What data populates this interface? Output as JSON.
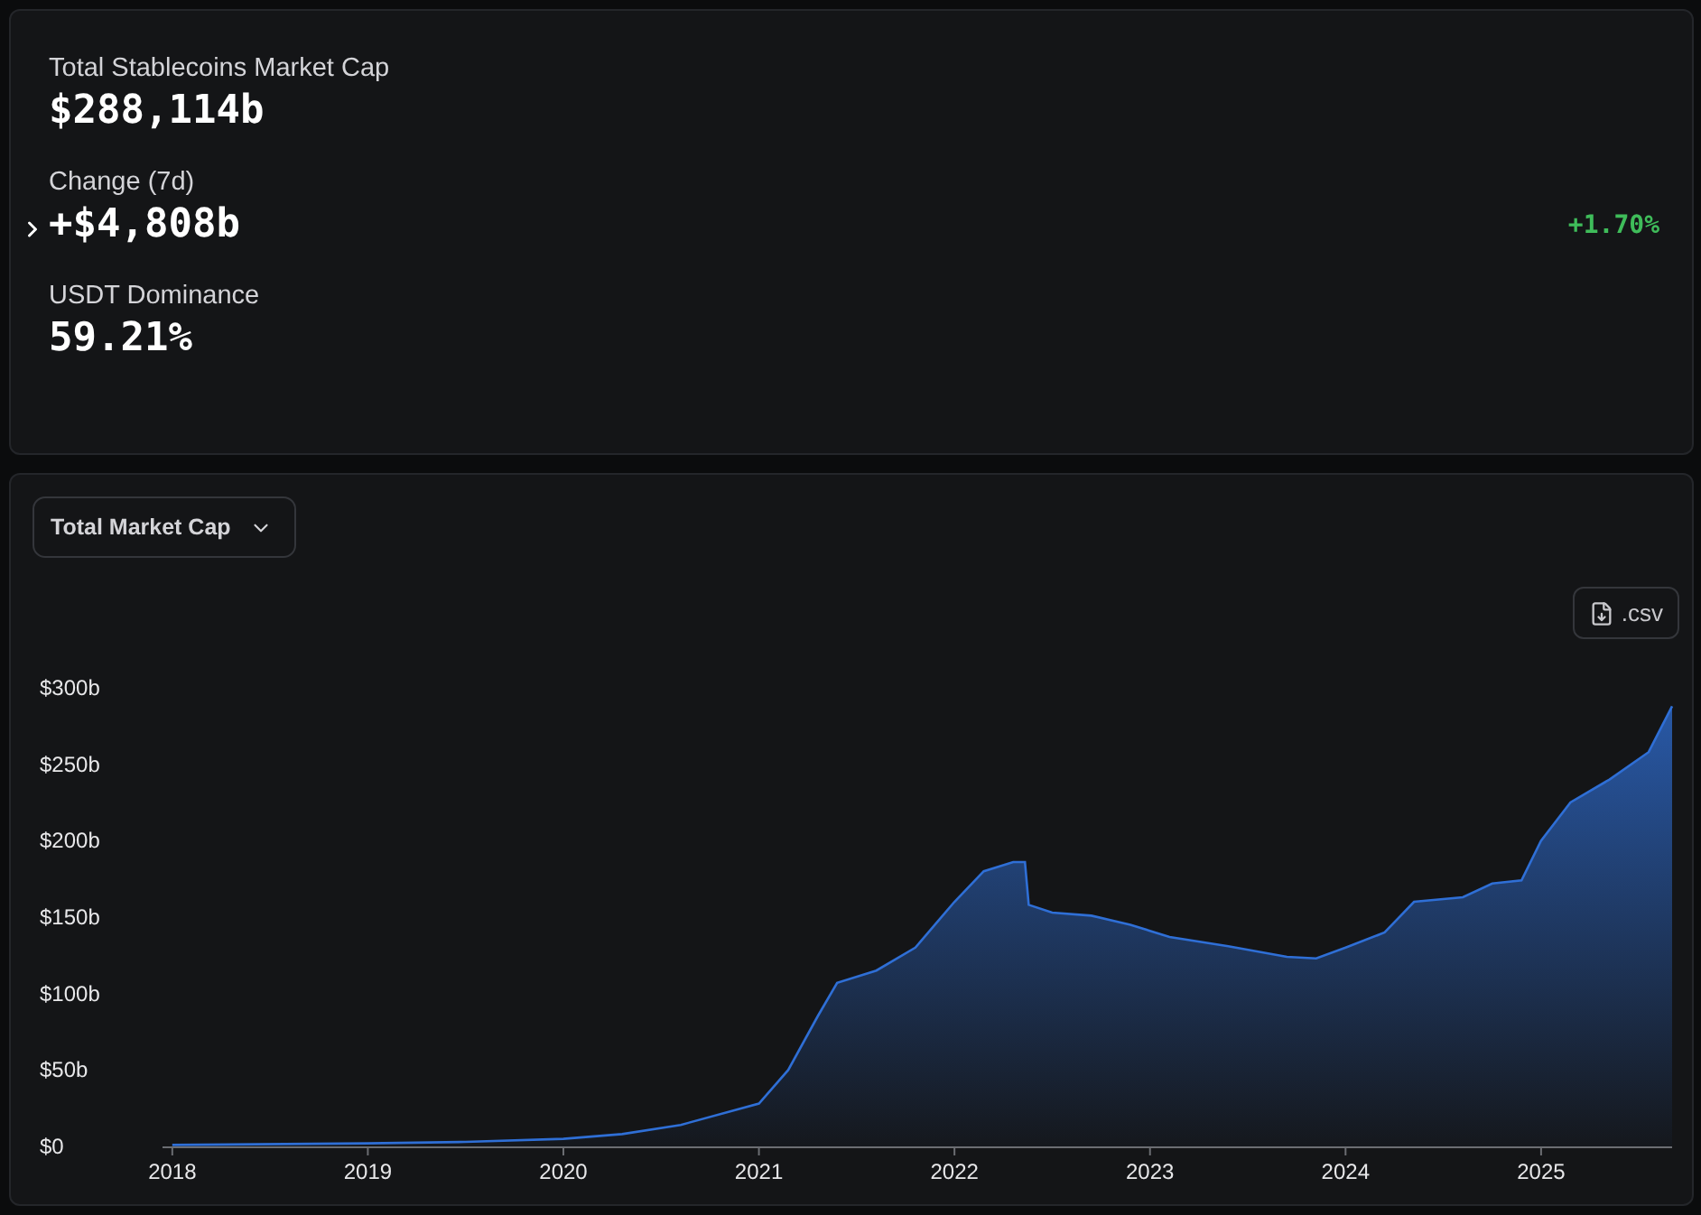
{
  "summary": {
    "stats": [
      {
        "label": "Total Stablecoins Market Cap",
        "value": "$288,114b"
      },
      {
        "label": "Change (7d)",
        "value": "+$4,808b",
        "change": "+1.70%",
        "expanded": false
      },
      {
        "label": "USDT Dominance",
        "value": "59.21%"
      }
    ]
  },
  "chart_panel": {
    "metric_select": {
      "value": "Total Market Cap"
    },
    "export_button": {
      "label": ".csv"
    },
    "chart_data": {
      "type": "area",
      "x": [
        2018.0,
        2019.0,
        2019.5,
        2020.0,
        2020.3,
        2020.6,
        2021.0,
        2021.15,
        2021.3,
        2021.4,
        2021.6,
        2021.8,
        2022.0,
        2022.15,
        2022.3,
        2022.36,
        2022.38,
        2022.5,
        2022.7,
        2022.9,
        2023.1,
        2023.4,
        2023.7,
        2023.85,
        2024.0,
        2024.2,
        2024.35,
        2024.6,
        2024.75,
        2024.9,
        2025.0,
        2025.15,
        2025.35,
        2025.55,
        2025.67
      ],
      "series": [
        {
          "color": "#2f6fd6",
          "values": [
            1,
            2,
            3,
            5,
            8,
            14,
            28,
            50,
            85,
            107,
            115,
            130,
            160,
            180,
            186,
            186,
            158,
            153,
            151,
            145,
            137,
            131,
            124,
            123,
            130,
            140,
            160,
            163,
            172,
            174,
            200,
            225,
            240,
            258,
            288
          ]
        }
      ],
      "xlim": [
        2017.95,
        2025.67
      ],
      "ylim": [
        0,
        300
      ],
      "xticks": [
        {
          "value": 2018,
          "label": "2018"
        },
        {
          "value": 2019,
          "label": "2019"
        },
        {
          "value": 2020,
          "label": "2020"
        },
        {
          "value": 2021,
          "label": "2021"
        },
        {
          "value": 2022,
          "label": "2022"
        },
        {
          "value": 2023,
          "label": "2023"
        },
        {
          "value": 2024,
          "label": "2024"
        },
        {
          "value": 2025,
          "label": "2025"
        }
      ],
      "yticks": [
        {
          "value": 0,
          "label": "$0"
        },
        {
          "value": 50,
          "label": "$50b"
        },
        {
          "value": 100,
          "label": "$100b"
        },
        {
          "value": 150,
          "label": "$150b"
        },
        {
          "value": 200,
          "label": "$200b"
        },
        {
          "value": 250,
          "label": "$250b"
        },
        {
          "value": 300,
          "label": "$300b"
        }
      ]
    }
  }
}
